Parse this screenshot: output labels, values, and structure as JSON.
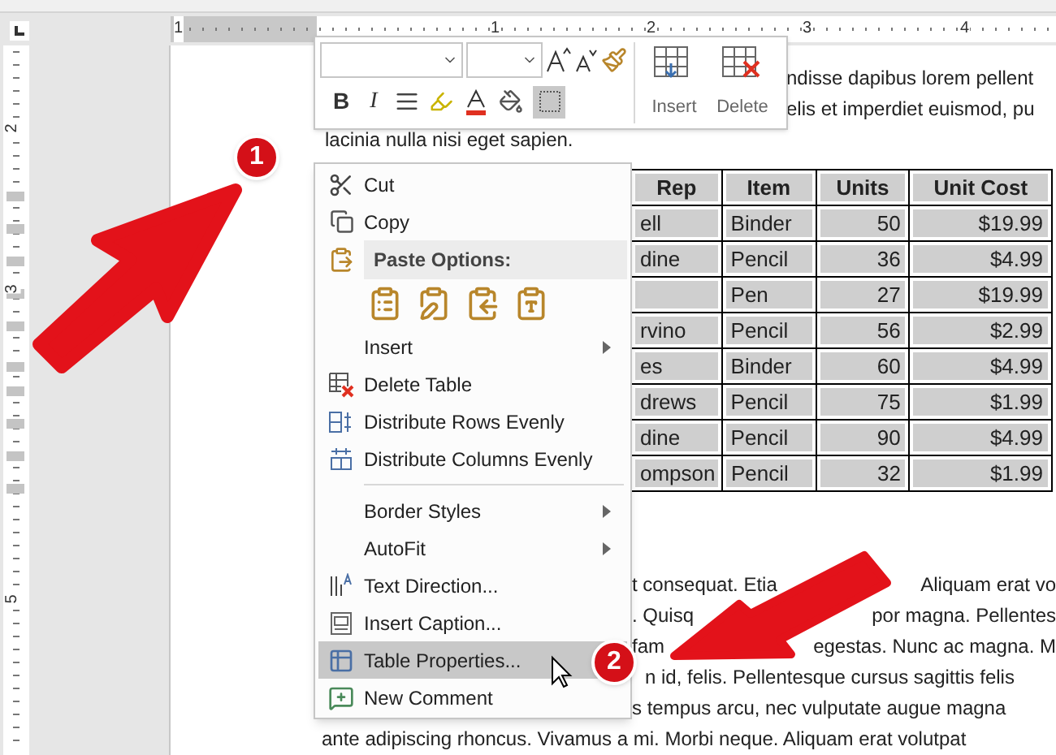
{
  "rulers": {
    "horizontal_labels": [
      "1",
      "1",
      "2",
      "3",
      "4"
    ],
    "vertical_labels": [
      "2",
      "3",
      "5"
    ]
  },
  "mini_toolbar": {
    "format_buttons": [
      {
        "label": "B"
      },
      {
        "label": "I"
      }
    ],
    "borders_selected": true,
    "table_buttons": [
      {
        "label": "Insert"
      },
      {
        "label": "Delete"
      }
    ]
  },
  "document": {
    "top_lines": [
      "ndisse dapibus lorem pellent",
      "elis et imperdiet euismod, pu",
      "lacinia nulla nisi eget sapien."
    ],
    "table": {
      "columns": [
        "Rep",
        "Item",
        "Units",
        "Unit Cost"
      ],
      "rows": [
        [
          "ell",
          "Binder",
          "50",
          "$19.99"
        ],
        [
          "dine",
          "Pencil",
          "36",
          "$4.99"
        ],
        [
          null,
          "Pen",
          "27",
          "$19.99"
        ],
        [
          "rvino",
          "Pencil",
          "56",
          "$2.99"
        ],
        [
          "es",
          "Binder",
          "60",
          "$4.99"
        ],
        [
          "drews",
          "Pencil",
          "75",
          "$1.99"
        ],
        [
          "dine",
          "Pencil",
          "90",
          "$4.99"
        ],
        [
          "ompson",
          "Pencil",
          "32",
          "$1.99"
        ]
      ]
    },
    "bottom_lines": [
      [
        "t consequat. Etia",
        "Aliquam erat vo"
      ],
      [
        ". Quisq",
        "por magna. Pellentes"
      ],
      [
        "fam",
        "egestas. Nunc ac magna. M"
      ],
      [
        "n id, felis. Pellentesque cursus sagittis felis"
      ],
      [
        "s tempus arcu, nec vulputate augue magna"
      ],
      [
        "ante adipiscing rhoncus. Vivamus a mi. Morbi neque. Aliquam erat volutpat"
      ]
    ]
  },
  "context_menu": {
    "items": [
      {
        "kind": "command",
        "label": "Cut",
        "submenu": false,
        "selected": false
      },
      {
        "kind": "command",
        "label": "Copy",
        "submenu": false,
        "selected": false
      },
      {
        "kind": "header",
        "label": "Paste Options:"
      },
      {
        "kind": "paste_icons"
      },
      {
        "kind": "command",
        "label": "Insert",
        "submenu": true,
        "selected": false
      },
      {
        "kind": "command",
        "label": "Delete Table",
        "submenu": false,
        "selected": false
      },
      {
        "kind": "command",
        "label": "Distribute Rows Evenly",
        "submenu": false,
        "selected": false
      },
      {
        "kind": "command",
        "label": "Distribute Columns Evenly",
        "submenu": false,
        "selected": false
      },
      {
        "kind": "separator"
      },
      {
        "kind": "command",
        "label": "Border Styles",
        "submenu": true,
        "selected": false
      },
      {
        "kind": "command",
        "label": "AutoFit",
        "submenu": true,
        "selected": false
      },
      {
        "kind": "command",
        "label": "Text Direction...",
        "submenu": false,
        "selected": false
      },
      {
        "kind": "command",
        "label": "Insert Caption...",
        "submenu": false,
        "selected": false
      },
      {
        "kind": "command",
        "label": "Table Properties...",
        "submenu": false,
        "selected": true
      },
      {
        "kind": "command",
        "label": "New Comment",
        "submenu": false,
        "selected": false
      }
    ]
  },
  "callouts": [
    {
      "label": "1"
    },
    {
      "label": "2"
    }
  ]
}
